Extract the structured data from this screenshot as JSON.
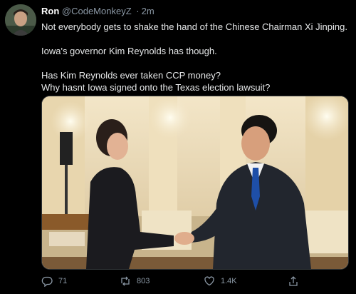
{
  "tweet": {
    "author_name": "Ron",
    "author_handle": "@CodeMonkeyZ",
    "separator": "·",
    "timestamp": "2m",
    "lines": [
      "Not everybody gets to shake the hand of the Chinese Chairman Xi Jinping.",
      "Iowa's governor Kim Reynolds has though.",
      "Has Kim Reynolds ever taken CCP money?",
      "Why hasnt Iowa signed onto the Texas election lawsuit?"
    ]
  },
  "actions": {
    "replies": "71",
    "retweets": "803",
    "likes": "1.4K"
  },
  "icons": {
    "reply": "comment-bubble-icon",
    "retweet": "retweet-arrows-icon",
    "like": "heart-icon",
    "share": "share-upload-icon"
  },
  "colors": {
    "background": "#000000",
    "text": "#e7e9ea",
    "muted": "#8b98a5",
    "border": "#2f3336"
  }
}
